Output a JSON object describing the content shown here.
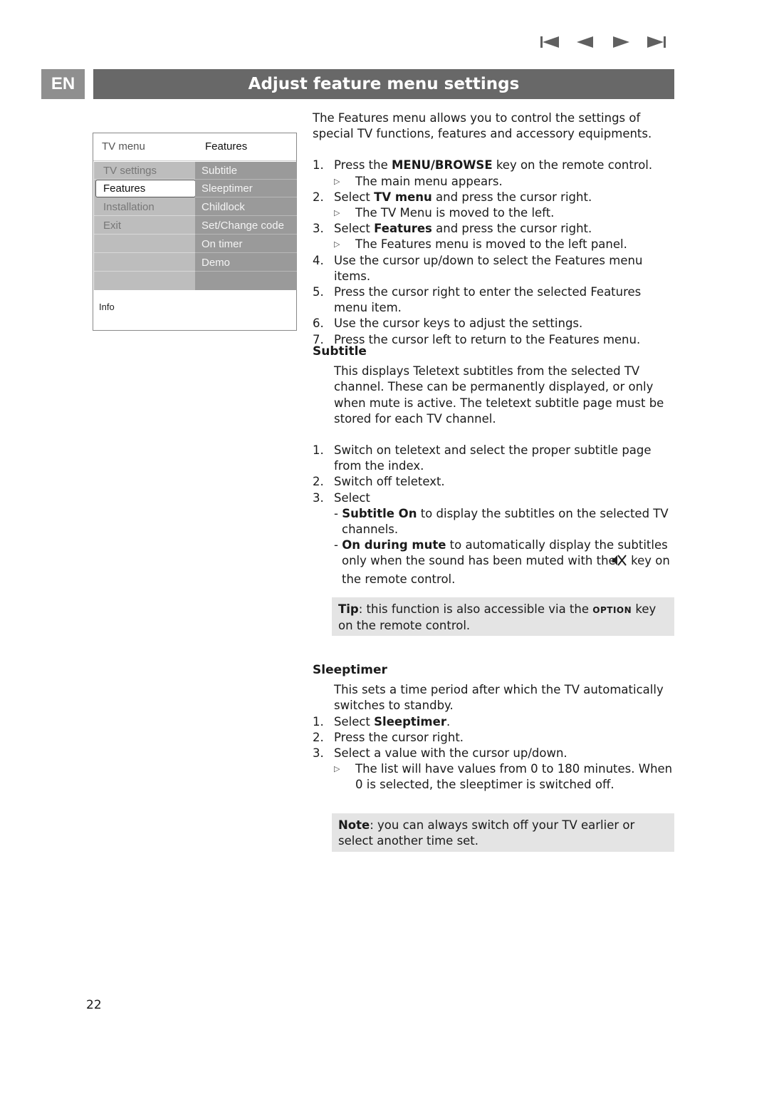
{
  "nav": {
    "buttons": [
      {
        "name": "first-page",
        "icon": "skip-back-icon"
      },
      {
        "name": "previous-page",
        "icon": "triangle-left-icon"
      },
      {
        "name": "next-page",
        "icon": "triangle-right-icon"
      },
      {
        "name": "last-page",
        "icon": "skip-forward-icon"
      }
    ]
  },
  "header": {
    "lang": "EN",
    "title": "Adjust feature menu settings",
    "title_bg": "#686868",
    "lang_bg": "#8f8f8f"
  },
  "tv_menu": {
    "left_title": "TV menu",
    "right_title": "Features",
    "left_items": [
      "TV settings",
      "Features",
      "Installation",
      "Exit",
      "",
      "",
      ""
    ],
    "selected_index": 1,
    "right_items": [
      "Subtitle",
      "Sleeptimer",
      "Childlock",
      "Set/Change code",
      "On timer",
      "Demo",
      ""
    ],
    "info_label": "Info"
  },
  "intro": "The Features menu allows you to control the settings of special TV functions, features and accessory equipments.",
  "steps": [
    {
      "num": "1.",
      "pre": "Press the ",
      "bold": "MENU/BROWSE",
      "post": " key on the remote control.",
      "result": "The main menu appears."
    },
    {
      "num": "2.",
      "pre": "Select ",
      "bold": "TV menu",
      "post": " and press the cursor right.",
      "result": "The TV Menu is moved to the left."
    },
    {
      "num": "3.",
      "pre": "Select ",
      "bold": "Features",
      "post": " and press the cursor right.",
      "result": "The Features menu is moved to the left panel."
    },
    {
      "num": "4.",
      "text": "Use the cursor up/down to select the Features menu items."
    },
    {
      "num": "5.",
      "text": "Press the cursor right to enter the selected Features menu item."
    },
    {
      "num": "6.",
      "text": "Use the cursor keys to adjust the settings."
    },
    {
      "num": "7.",
      "text": "Press the cursor left to return to the Features menu."
    }
  ],
  "subtitle": {
    "heading": "Subtitle",
    "description": "This displays Teletext subtitles from the selected TV channel. These can be permanently displayed, or only when mute is active. The teletext subtitle page must be stored for each TV channel.",
    "steps": [
      {
        "num": "1.",
        "text": "Switch on teletext and select the proper subtitle page from the index."
      },
      {
        "num": "2.",
        "text": "Switch off teletext."
      },
      {
        "num": "3.",
        "text": "Select"
      }
    ],
    "options": [
      {
        "bold": "Subtitle On",
        "text": " to display the subtitles on the selected TV channels."
      },
      {
        "bold": "On during mute",
        "text_before_icon": " to automatically display the subtitles only when the sound has been muted with the ",
        "icon": "mute-icon",
        "text_after_icon": " key on the remote control."
      }
    ],
    "tip": {
      "label": "Tip",
      "pre": ": this function is also accessible via the ",
      "key": "OPTION",
      "post": " key on the remote control."
    }
  },
  "sleeptimer": {
    "heading": "Sleeptimer",
    "description": "This sets a time period after which the TV automatically switches to standby.",
    "steps": [
      {
        "num": "1.",
        "pre": "Select ",
        "bold": "Sleeptimer",
        "post": "."
      },
      {
        "num": "2.",
        "text": "Press the cursor right."
      },
      {
        "num": "3.",
        "text": "Select a value with the cursor up/down.",
        "result": "The list will have values from 0 to 180 minutes. When 0 is selected, the sleeptimer is switched off."
      }
    ],
    "note": {
      "label": "Note",
      "text": ": you can always switch off your TV earlier or select another time set."
    }
  },
  "page_number": "22"
}
